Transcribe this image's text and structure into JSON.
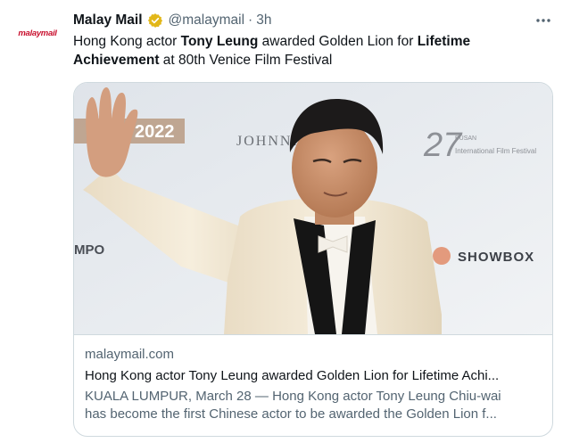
{
  "tweet": {
    "avatar_text": "malaymail",
    "author": {
      "name": "Malay Mail",
      "handle": "@malaymail",
      "separator": "·",
      "time": "3h"
    },
    "text_parts": [
      {
        "text": "Hong Kong actor ",
        "bold": false
      },
      {
        "text": "Tony Leung",
        "bold": true
      },
      {
        "text": " awarded Golden Lion for ",
        "bold": false
      },
      {
        "text": "Lifetime Achievement",
        "bold": true
      },
      {
        "text": " at 80th Venice Film Festival",
        "bold": false
      }
    ],
    "colors": {
      "verified_badge": "#e2b719",
      "brand": "#c8102e",
      "secondary_text": "#536471",
      "border": "#cfd9de"
    }
  },
  "card": {
    "domain": "malaymail.com",
    "title": "Hong Kong actor Tony Leung awarded Golden Lion for Lifetime Achi...",
    "description_line1": "KUALA LUMPUR, March 28 — Hong Kong actor Tony Leung Chiu-wai",
    "description_line2": "has become the first Chinese actor to be awarded the Golden Lion f...",
    "backdrop_texts": {
      "year": "2022",
      "sponsor": "JOHNNIE",
      "festival_num": "27",
      "festival_line1": "BUSAN",
      "festival_line2": "International Film Festival",
      "partner_left": "MPO",
      "partner_right": "SHOWBOX"
    }
  }
}
